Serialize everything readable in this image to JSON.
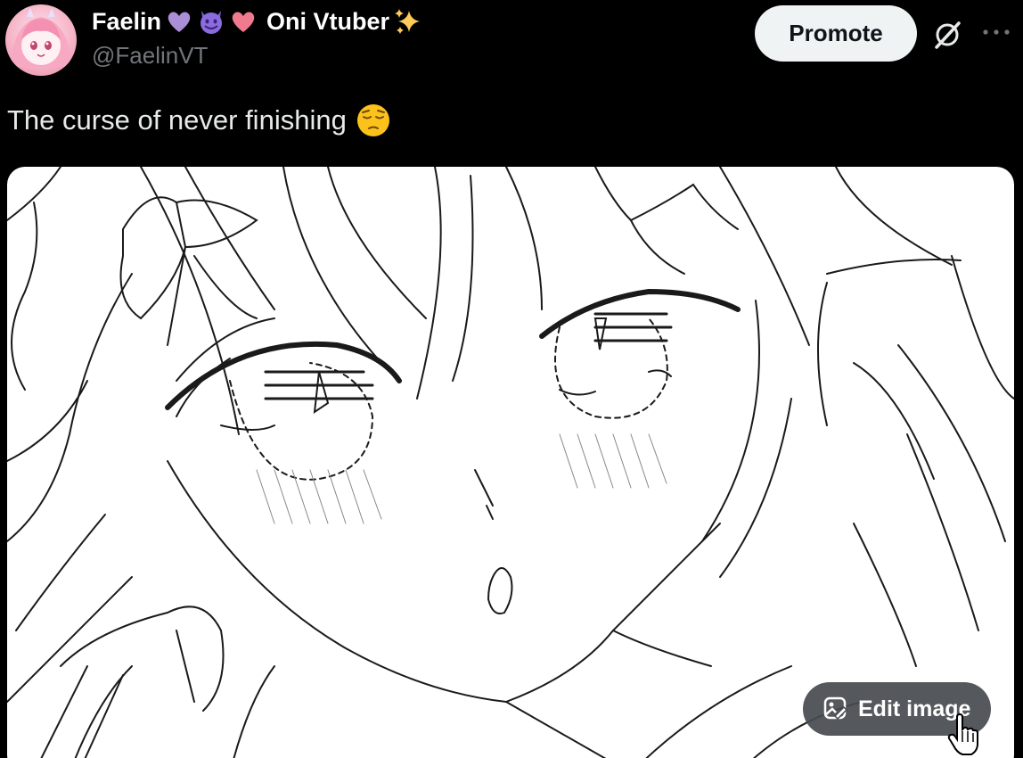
{
  "author": {
    "name_prefix": "Faelin",
    "name_emojis": [
      "purple-heart-icon",
      "smiling-imp-icon",
      "pink-heart-icon"
    ],
    "name_suffix": "Oni Vtuber",
    "name_suffix_emoji": "sparkles-icon",
    "handle": "@FaelinVT"
  },
  "actions": {
    "promote_label": "Promote",
    "grok_icon": "grok-icon",
    "more_icon": "more-icon"
  },
  "tweet": {
    "text": "The curse of never finishing",
    "emoji": "pensive-face-icon"
  },
  "media": {
    "description_icon": "sketch-image",
    "edit_label": "Edit image"
  },
  "colors": {
    "background": "#000000",
    "handle": "#71767b",
    "button_bg": "#eff3f4",
    "button_text": "#0f1419",
    "purple_heart": "#aa8ed6",
    "imp": "#7b5cd6",
    "pink_heart": "#f07b8e",
    "sparkle": "#fdcb58",
    "pensive": "#fcc21b"
  }
}
